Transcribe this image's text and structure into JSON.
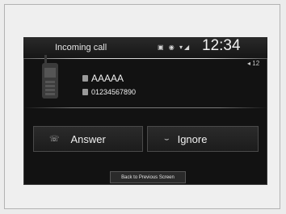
{
  "statusbar": {
    "title": "Incoming call",
    "icons": "▣  ◉ ▾◢",
    "time": "12:34"
  },
  "volume": "◂ 12",
  "caller": {
    "name": "AAAAA",
    "number": "01234567890"
  },
  "buttons": {
    "answer": "Answer",
    "ignore": "Ignore",
    "back": "Back to Previous Screen",
    "answer_icon": "☏",
    "ignore_icon": "⌣"
  },
  "colors": {
    "screen_bg": "#121212",
    "text": "#f0f0f0"
  }
}
